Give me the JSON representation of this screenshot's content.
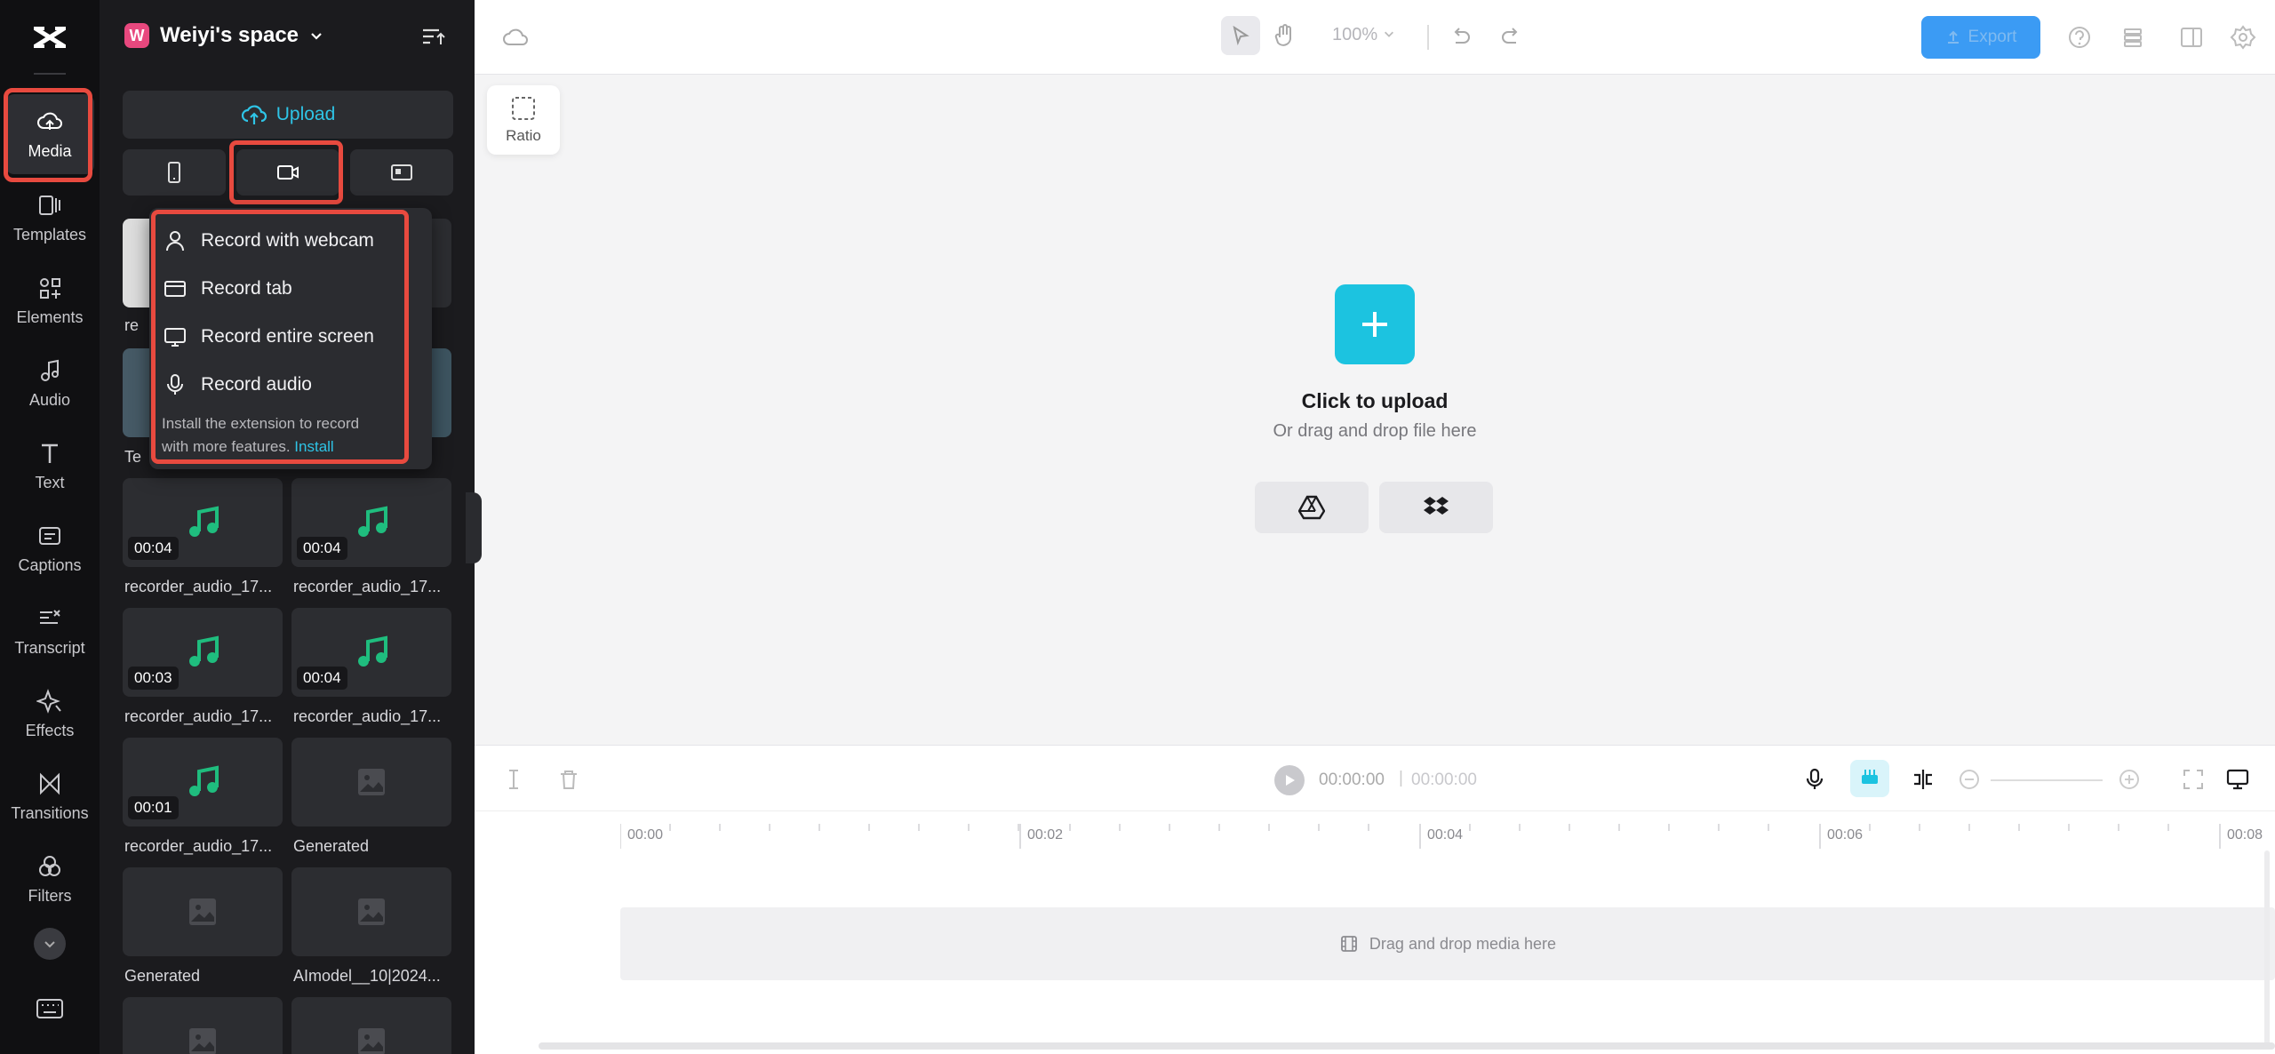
{
  "rail": {
    "items": [
      {
        "key": "media",
        "label": "Media",
        "icon": "cloud-upload-icon"
      },
      {
        "key": "templates",
        "label": "Templates",
        "icon": "templates-icon"
      },
      {
        "key": "elements",
        "label": "Elements",
        "icon": "elements-icon"
      },
      {
        "key": "audio",
        "label": "Audio",
        "icon": "music-note-icon"
      },
      {
        "key": "text",
        "label": "Text",
        "icon": "text-t-icon"
      },
      {
        "key": "captions",
        "label": "Captions",
        "icon": "captions-icon"
      },
      {
        "key": "transcript",
        "label": "Transcript",
        "icon": "transcript-icon"
      },
      {
        "key": "effects",
        "label": "Effects",
        "icon": "sparkle-icon"
      },
      {
        "key": "transitions",
        "label": "Transitions",
        "icon": "transitions-icon"
      },
      {
        "key": "filters",
        "label": "Filters",
        "icon": "filters-icon"
      }
    ]
  },
  "panel": {
    "space_initial": "W",
    "space_name": "Weiyi's space",
    "upload_label": "Upload",
    "media": [
      {
        "duration": "",
        "label": "re"
      },
      {
        "duration": "",
        "label": ""
      },
      {
        "duration": "",
        "label": "Te"
      },
      {
        "duration": "",
        "label": ""
      },
      {
        "duration": "00:04",
        "label": "recorder_audio_17..."
      },
      {
        "duration": "00:04",
        "label": "recorder_audio_17..."
      },
      {
        "duration": "00:03",
        "label": "recorder_audio_17..."
      },
      {
        "duration": "00:04",
        "label": "recorder_audio_17..."
      },
      {
        "duration": "00:01",
        "label": "recorder_audio_17..."
      },
      {
        "duration": "",
        "label": "Generated"
      },
      {
        "duration": "",
        "label": "Generated"
      },
      {
        "duration": "",
        "label": "AImodel__10|2024..."
      }
    ]
  },
  "record_menu": {
    "items": [
      "Record with webcam",
      "Record tab",
      "Record entire screen",
      "Record audio"
    ],
    "hint_line1": "Install the extension to record",
    "hint_line2": "with more features.",
    "install_link": "Install"
  },
  "topbar": {
    "zoom": "100%",
    "export_label": "Export"
  },
  "canvas": {
    "ratio_label": "Ratio",
    "click_to_upload": "Click to upload",
    "drag_drop": "Or drag and drop file here"
  },
  "timeline": {
    "current_time": "00:00:00",
    "separator": "|",
    "total_time": "00:00:00",
    "ticks": [
      "00:00",
      "00:02",
      "00:04",
      "00:06",
      "00:08"
    ],
    "drop_hint": "Drag and drop media here"
  },
  "colors": {
    "accent": "#1cc3e0",
    "highlight": "#e84a3f",
    "export_button": "#3b9bf4"
  }
}
